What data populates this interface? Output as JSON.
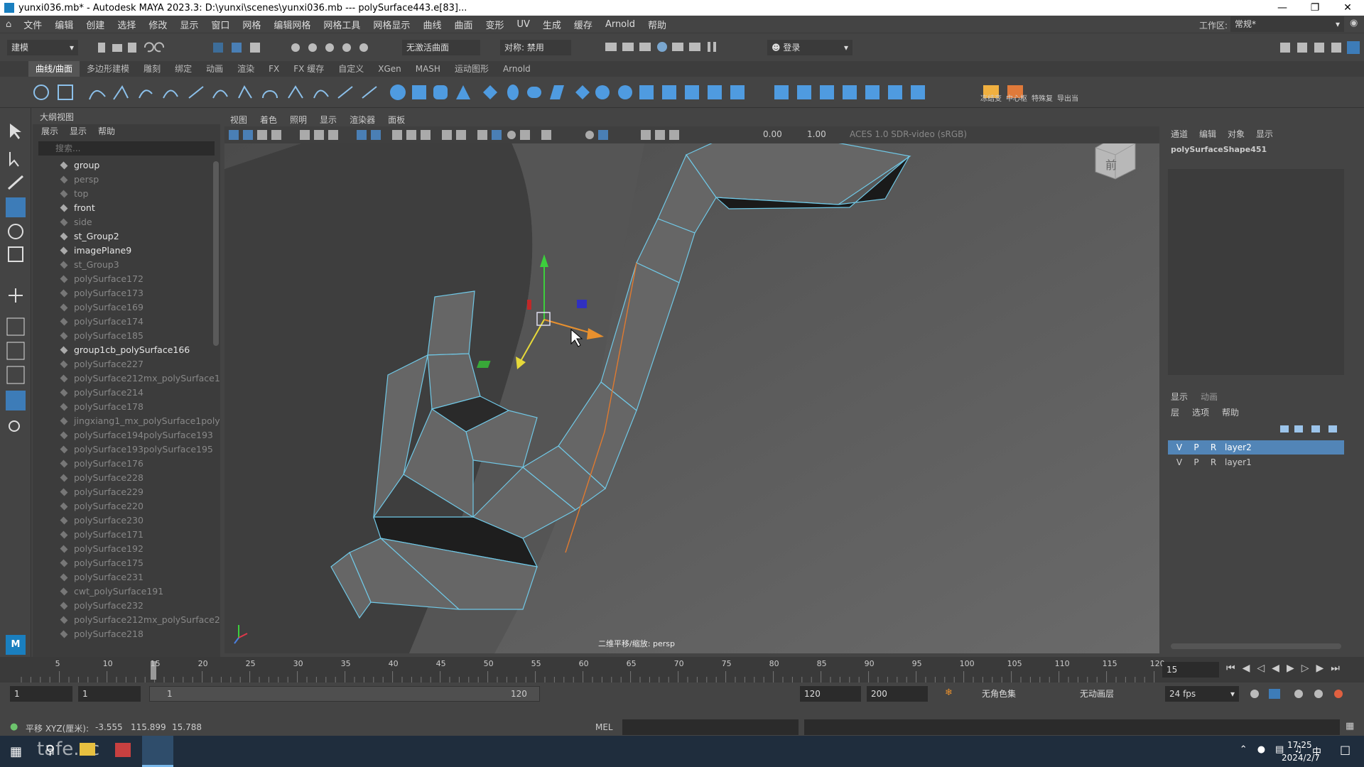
{
  "title": "yunxi036.mb* - Autodesk MAYA 2023.3: D:\\yunxi\\scenes\\yunxi036.mb  ---  polySurface443.e[83]...",
  "menu": [
    "文件",
    "编辑",
    "创建",
    "选择",
    "修改",
    "显示",
    "窗口",
    "网格",
    "编辑网格",
    "网格工具",
    "网格显示",
    "曲线",
    "曲面",
    "变形",
    "UV",
    "生成",
    "缓存",
    "Arnold",
    "帮助"
  ],
  "workspace": {
    "label": "工作区:",
    "value": "常规*"
  },
  "status": {
    "mode": "建模",
    "live_surface": "无激活曲面",
    "symmetry": "对称: 禁用",
    "login": "登录"
  },
  "shelf_tabs": [
    "曲线/曲面",
    "多边形建模",
    "雕刻",
    "绑定",
    "动画",
    "渲染",
    "FX",
    "FX 缓存",
    "自定义",
    "XGen",
    "MASH",
    "运动图形",
    "Arnold"
  ],
  "shelf_labels": [
    "冻结变",
    "中心枢",
    "特殊复",
    "导出当"
  ],
  "outliner": {
    "title": "大纲视图",
    "menu": [
      "展示",
      "显示",
      "帮助"
    ],
    "search_placeholder": "搜索...",
    "items": [
      {
        "label": "group",
        "style": "bright"
      },
      {
        "label": "persp",
        "style": "dim"
      },
      {
        "label": "top",
        "style": "dim"
      },
      {
        "label": "front",
        "style": "bright"
      },
      {
        "label": "side",
        "style": "dim"
      },
      {
        "label": "st_Group2",
        "style": "bright"
      },
      {
        "label": "imagePlane9",
        "style": "bright"
      },
      {
        "label": "st_Group3",
        "style": "dim"
      },
      {
        "label": "polySurface172",
        "style": "dim"
      },
      {
        "label": "polySurface173",
        "style": "dim"
      },
      {
        "label": "polySurface169",
        "style": "dim"
      },
      {
        "label": "polySurface174",
        "style": "dim"
      },
      {
        "label": "polySurface185",
        "style": "dim"
      },
      {
        "label": "group1cb_polySurface166",
        "style": "bright"
      },
      {
        "label": "polySurface227",
        "style": "dim"
      },
      {
        "label": "polySurface212mx_polySurface1",
        "style": "dim"
      },
      {
        "label": "polySurface214",
        "style": "dim"
      },
      {
        "label": "polySurface178",
        "style": "dim"
      },
      {
        "label": "jingxiang1_mx_polySurface1polyS",
        "style": "dim"
      },
      {
        "label": "polySurface194polySurface193",
        "style": "dim"
      },
      {
        "label": "polySurface193polySurface195",
        "style": "dim"
      },
      {
        "label": "polySurface176",
        "style": "dim"
      },
      {
        "label": "polySurface228",
        "style": "dim"
      },
      {
        "label": "polySurface229",
        "style": "dim"
      },
      {
        "label": "polySurface220",
        "style": "dim"
      },
      {
        "label": "polySurface230",
        "style": "dim"
      },
      {
        "label": "polySurface171",
        "style": "dim"
      },
      {
        "label": "polySurface192",
        "style": "dim"
      },
      {
        "label": "polySurface175",
        "style": "dim"
      },
      {
        "label": "polySurface231",
        "style": "dim"
      },
      {
        "label": "cwt_polySurface191",
        "style": "dim"
      },
      {
        "label": "polySurface232",
        "style": "dim"
      },
      {
        "label": "polySurface212mx_polySurface2",
        "style": "dim"
      },
      {
        "label": "polySurface218",
        "style": "dim"
      }
    ]
  },
  "viewport": {
    "menu": [
      "视图",
      "着色",
      "照明",
      "显示",
      "渲染器",
      "面板"
    ],
    "exposure": "0.00",
    "gamma": "1.00",
    "colorspace": "ACES 1.0 SDR-video (sRGB)",
    "hud_label": "二维平移/缩放: persp",
    "viewcube_label": "前"
  },
  "channel_box": {
    "menu": [
      "通道",
      "编辑",
      "对象",
      "显示"
    ],
    "object": "polySurfaceShape451"
  },
  "layer_editor": {
    "tabs": [
      "显示",
      "动画"
    ],
    "menu": [
      "层",
      "选项",
      "帮助"
    ],
    "layers": [
      {
        "v": "V",
        "p": "P",
        "r": "R",
        "name": "layer2",
        "selected": true
      },
      {
        "v": "V",
        "p": "P",
        "r": "R",
        "name": "layer1",
        "selected": false
      }
    ]
  },
  "timeline": {
    "ticks": [
      "5",
      "10",
      "15",
      "20",
      "25",
      "30",
      "35",
      "40",
      "45",
      "50",
      "55",
      "60",
      "65",
      "70",
      "75",
      "80",
      "85",
      "90",
      "95",
      "100",
      "105",
      "110",
      "115",
      "120"
    ],
    "current_frame": "15"
  },
  "range": {
    "start": "1",
    "anim_start": "1",
    "range_start_label": "1",
    "range_end_label": "120",
    "end": "120",
    "anim_end": "200",
    "char_set": "无角色集",
    "anim_layer": "无动画层",
    "fps": "24 fps"
  },
  "cmdline": {
    "help_label": "平移 XYZ(厘米):",
    "x": "-3.555",
    "y": "115.899",
    "z": "15.788",
    "lang": "MEL"
  },
  "taskbar": {
    "time": "17:25",
    "date": "2024/2/7",
    "ime": "中",
    "watermark": "tafe.cc"
  }
}
